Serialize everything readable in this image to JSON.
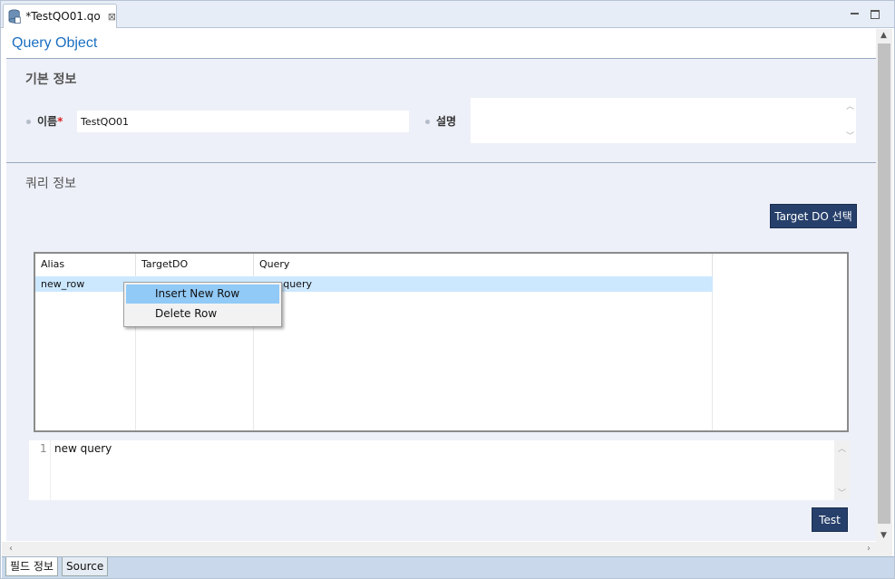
{
  "tab": {
    "title": "*TestQO01.qo",
    "close_glyph": "⊠"
  },
  "page_title": "Query Object",
  "basic_info": {
    "title": "기본 정보",
    "name_label": "이름",
    "required_mark": "*",
    "name_value": "TestQO01",
    "desc_label": "설명",
    "desc_value": ""
  },
  "query_info": {
    "title": "쿼리 정보",
    "target_button": "Target DO 선택",
    "columns": [
      "Alias",
      "TargetDO",
      "Query"
    ],
    "rows": [
      {
        "alias": "new_row",
        "target_do": "",
        "query": "new query"
      }
    ],
    "editor": {
      "line_number": "1",
      "code": "new query"
    },
    "test_button": "Test"
  },
  "context_menu": {
    "items": [
      "Insert New Row",
      "Delete Row"
    ],
    "highlighted_index": 0
  },
  "bottom_tabs": [
    "필드 정보",
    "Source"
  ],
  "colors": {
    "accent": "#1a6fc2",
    "button": "#27406b",
    "selection": "#cce8ff",
    "menu_highlight": "#91c9f7"
  }
}
